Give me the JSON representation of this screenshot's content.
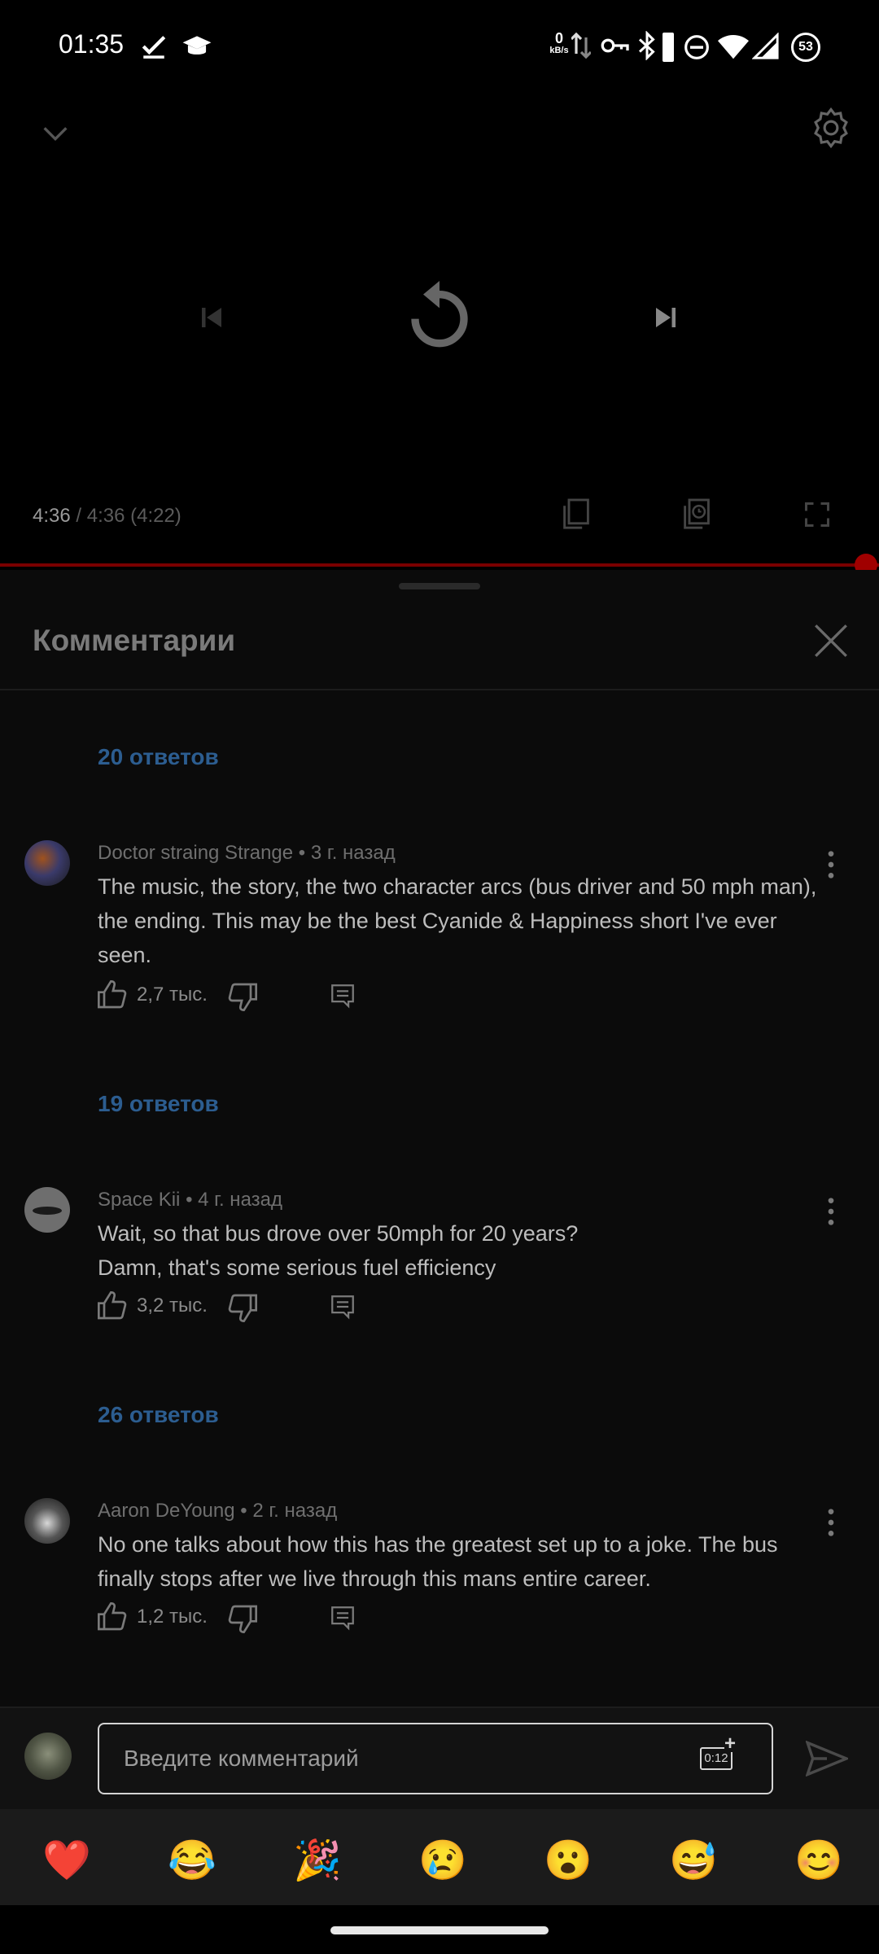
{
  "status_bar": {
    "time": "01:35",
    "net_speed_value": "0",
    "net_speed_unit": "kB/s",
    "battery": "53"
  },
  "player": {
    "time_current": "4:36",
    "time_total": "/ 4:36 (4:22)",
    "progress": 1.0
  },
  "comments": {
    "title": "Комментарии",
    "items": [
      {
        "replies": "20 ответов"
      },
      {
        "author": "Doctor straing Strange",
        "time": "• 3 г. назад",
        "text": "The music, the story, the two character arcs (bus driver and 50 mph man), the ending. This may be the best Cyanide & Happiness short I've ever seen.",
        "likes": "2,7 тыс.",
        "replies": "19 ответов"
      },
      {
        "author": "Space Kii",
        "time": "• 4 г. назад",
        "text_line1": "Wait, so that bus drove over 50mph for 20 years?",
        "text_line2": "Damn, that's some serious fuel efficiency",
        "likes": "3,2 тыс.",
        "replies": "26 ответов"
      },
      {
        "author": "Aaron DeYoung",
        "time": "• 2 г. назад",
        "text": "No one talks about how this has the greatest set up to a joke. The bus finally stops after we live through this mans entire career.",
        "likes": "1,2 тыс."
      }
    ]
  },
  "composer": {
    "placeholder": "Введите комментарий",
    "timestamp_badge": "0:12"
  },
  "emojis": [
    "❤️",
    "😂",
    "🎉",
    "😢",
    "😮",
    "😅",
    "😊"
  ],
  "colors": {
    "accent_red": "#cc0000",
    "link_blue": "#2c5d90"
  }
}
